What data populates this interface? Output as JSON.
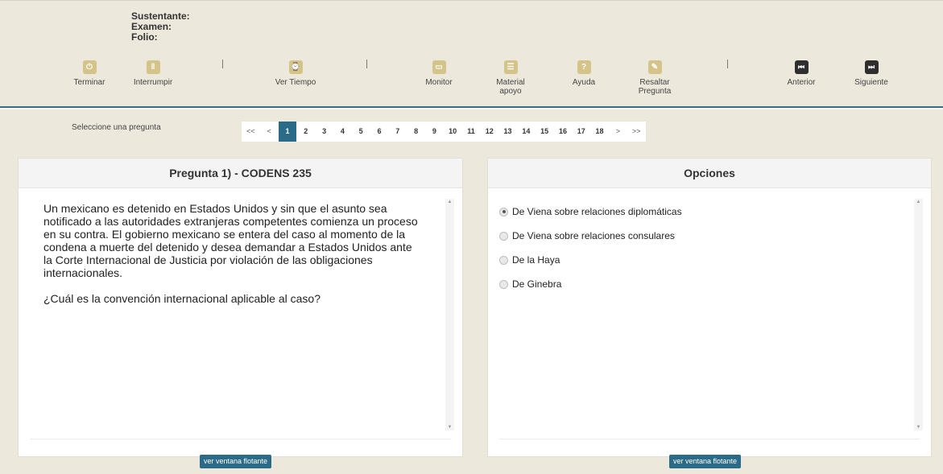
{
  "candidate": {
    "sustentante": "Sustentante:",
    "examen": "Examen:",
    "folio": "Folio:"
  },
  "toolbar": {
    "terminar": {
      "label": "Terminar",
      "icon": "power-icon"
    },
    "interrumpir": {
      "label": "Interrumpir",
      "icon": "pause-icon"
    },
    "ver_tiempo": {
      "label": "Ver Tiempo",
      "icon": "clock-icon"
    },
    "monitor": {
      "label": "Monitor",
      "icon": "monitor-icon"
    },
    "material": {
      "label1": "Material",
      "label2": "apoyo",
      "icon": "document-icon"
    },
    "ayuda": {
      "label": "Ayuda",
      "icon": "help-icon"
    },
    "resaltar": {
      "label1": "Resaltar",
      "label2": "Pregunta",
      "icon": "highlight-icon"
    },
    "anterior": {
      "label": "Anterior",
      "icon": "skip-back-icon"
    },
    "siguiente": {
      "label": "Siguiente",
      "icon": "skip-forward-icon"
    },
    "accent_color": "#d4c48a"
  },
  "navigation": {
    "prompt": "Seleccione una pregunta",
    "first": "<<",
    "prev": "<",
    "next": ">",
    "last": ">>",
    "pages": [
      "1",
      "2",
      "3",
      "4",
      "5",
      "6",
      "7",
      "8",
      "9",
      "10",
      "11",
      "12",
      "13",
      "14",
      "15",
      "16",
      "17",
      "18"
    ],
    "current": "1",
    "active_color": "#2c6b87"
  },
  "question": {
    "title": "Pregunta 1) - CODENS 235",
    "body": "Un mexicano es detenido en Estados Unidos y sin que el asunto sea notificado a las autoridades extranjeras competentes comienza  un proceso en su contra. El gobierno mexicano se entera del caso al momento de la condena a muerte del detenido y desea demandar a Estados Unidos ante la Corte Internacional de Justicia por violación de las obligaciones internacionales.",
    "ask": "¿Cuál es la convención internacional aplicable al caso?",
    "float_button": "ver ventana flotante"
  },
  "options": {
    "title": "Opciones",
    "items": [
      {
        "label": "De Viena sobre relaciones diplomáticas",
        "selected": true
      },
      {
        "label": "De Viena sobre relaciones consulares",
        "selected": false
      },
      {
        "label": "De la Haya",
        "selected": false
      },
      {
        "label": "De Ginebra",
        "selected": false
      }
    ],
    "float_button": "ver ventana flotante"
  }
}
